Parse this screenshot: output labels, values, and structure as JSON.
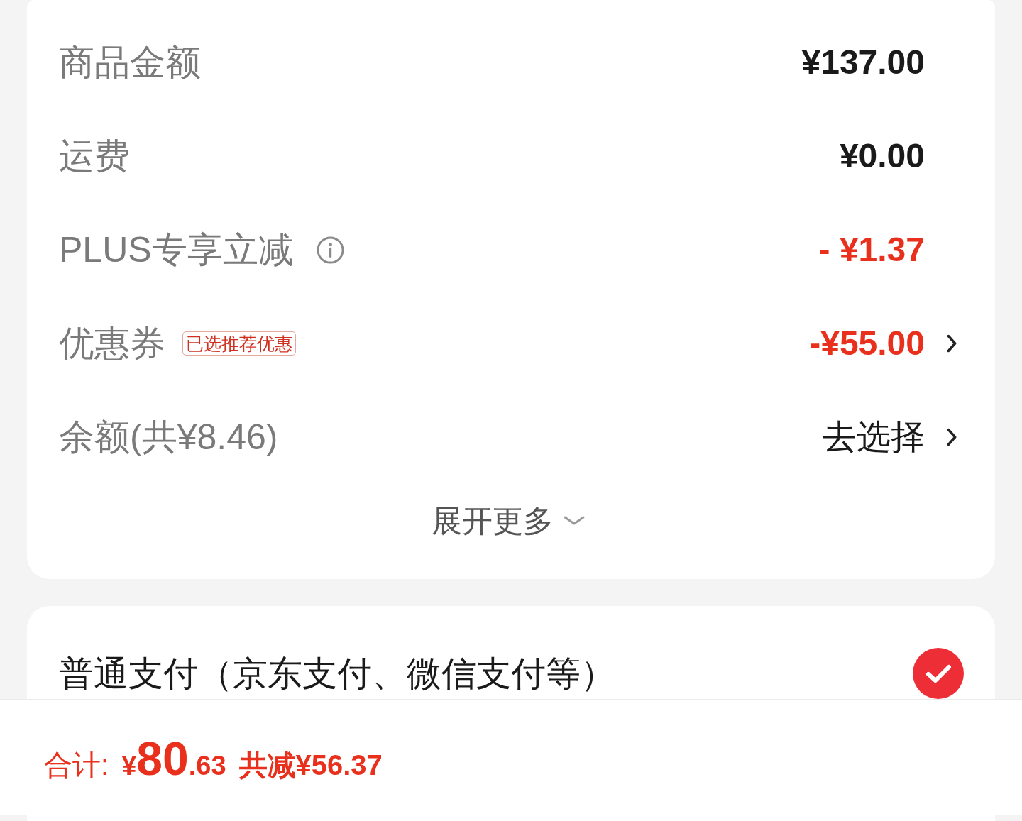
{
  "summary": {
    "rows": [
      {
        "label": "商品金额",
        "value": "¥137.00",
        "kind": "amount",
        "info": false,
        "chevron": false
      },
      {
        "label": "运费",
        "value": "¥0.00",
        "kind": "amount",
        "info": false,
        "chevron": false
      },
      {
        "label": "PLUS专享立减",
        "value": "- ¥1.37",
        "kind": "discount",
        "info": true,
        "chevron": false
      },
      {
        "label": "优惠券",
        "tag": "已选推荐优惠",
        "value": "-¥55.00",
        "kind": "discount",
        "info": false,
        "chevron": true
      },
      {
        "label": "余额(共¥8.46)",
        "value": "去选择",
        "kind": "action",
        "info": false,
        "chevron": true
      }
    ],
    "expand": {
      "label": "展开更多",
      "expanded": false
    }
  },
  "payment_options": [
    {
      "label": "普通支付（京东支付、微信支付等）",
      "selected": true
    }
  ],
  "bottom_bar": {
    "total_label": "合计:",
    "total_currency": "¥",
    "total_integer": "80",
    "total_decimal": ".63",
    "saved": "共减¥56.37"
  }
}
